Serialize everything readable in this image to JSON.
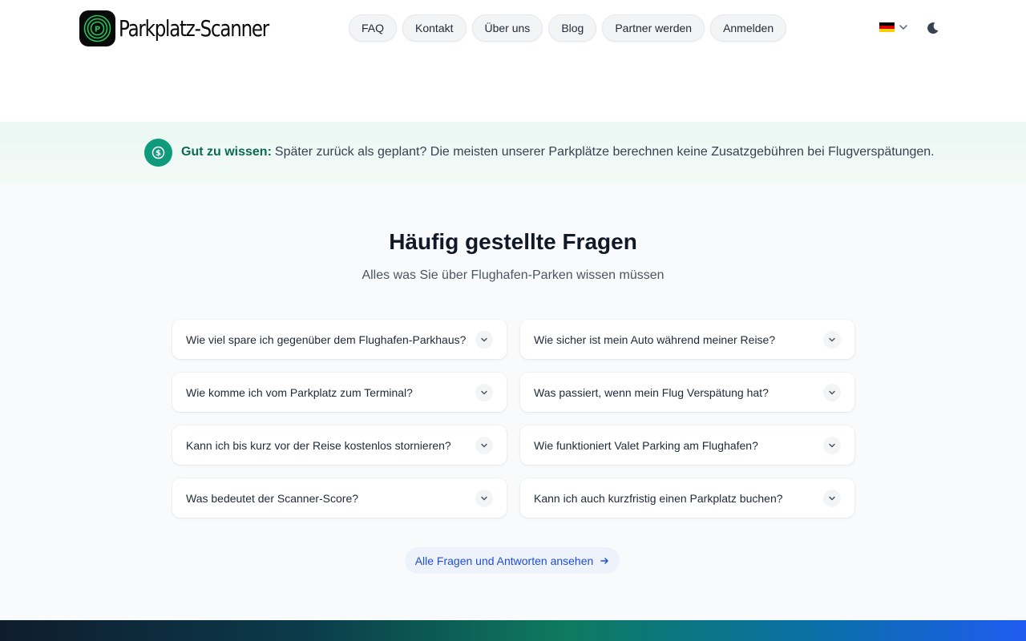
{
  "brand": {
    "name": "Parkplatz-Scanner",
    "logo_letter": "P"
  },
  "nav": {
    "items": [
      {
        "label": "FAQ"
      },
      {
        "label": "Kontakt"
      },
      {
        "label": "Über uns"
      },
      {
        "label": "Blog"
      },
      {
        "label": "Partner werden"
      },
      {
        "label": "Anmelden"
      }
    ]
  },
  "language": {
    "flag": "de",
    "colors": [
      "#000000",
      "#dd0000",
      "#ffce00"
    ]
  },
  "theme_toggle": {
    "icon": "moon-icon"
  },
  "banner": {
    "strong": "Gut zu wissen:",
    "text": "Später zurück als geplant? Die meisten unserer Parkplätze berechnen keine Zusatzgebühren bei Flugverspätungen.",
    "icon": "dollar-circle-icon",
    "accent": "#0f9a7b"
  },
  "faq": {
    "title": "Häufig gestellte Fragen",
    "subtitle": "Alles was Sie über Flughafen-Parken wissen müssen",
    "questions": [
      "Wie viel spare ich gegenüber dem Flughafen-Parkhaus?",
      "Wie sicher ist mein Auto während meiner Reise?",
      "Wie komme ich vom Parkplatz zum Terminal?",
      "Was passiert, wenn mein Flug Verspätung hat?",
      "Kann ich bis kurz vor der Reise kostenlos stornieren?",
      "Wie funktioniert Valet Parking am Flughafen?",
      "Was bedeutet der Scanner-Score?",
      "Kann ich auch kurzfristig einen Parkplatz buchen?"
    ],
    "all_link": "Alle Fragen und Antworten ansehen",
    "link_color": "#1d4ed8"
  }
}
